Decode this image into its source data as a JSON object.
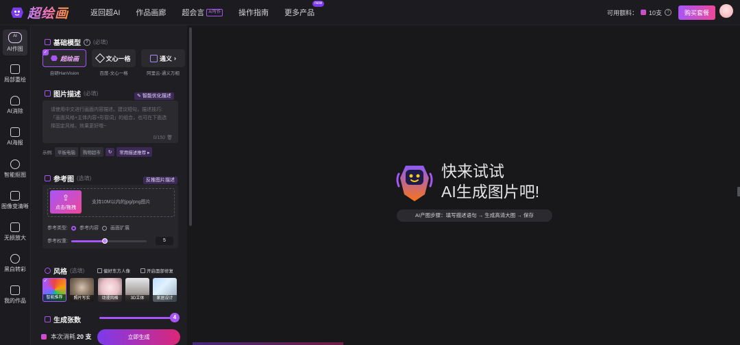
{
  "topbar": {
    "logo_text": "超绘画",
    "nav": [
      {
        "label": "返回超AI"
      },
      {
        "label": "作品画廊"
      },
      {
        "label": "超会言",
        "badge": "AI写作"
      },
      {
        "label": "操作指南"
      },
      {
        "label": "更多产品",
        "new_badge": "new"
      }
    ],
    "credits_label": "可用额料：",
    "credits_value": "10支",
    "buy_label": "购买套餐"
  },
  "rail": [
    {
      "label": "AI作图",
      "icon": "ai-icon",
      "active": true
    },
    {
      "label": "局部重绘",
      "icon": "edit-icon"
    },
    {
      "label": "AI消除",
      "icon": "eraser-icon"
    },
    {
      "label": "AI海报",
      "icon": "poster-icon"
    },
    {
      "label": "智能抠图",
      "icon": "cutout-icon"
    },
    {
      "label": "图像变清晰",
      "icon": "enhance-icon"
    },
    {
      "label": "无损放大",
      "icon": "upscale-icon"
    },
    {
      "label": "黑白转彩",
      "icon": "colorize-icon"
    },
    {
      "label": "我的作品",
      "icon": "works-icon"
    }
  ],
  "panel": {
    "base_model": {
      "title": "基础模型",
      "hint": "(必填)",
      "models": [
        {
          "name": "超绘画",
          "caption": "自研HanVision",
          "selected": true
        },
        {
          "name": "文心一格",
          "caption": "百度-文心一格"
        },
        {
          "name": "通义",
          "caption": "阿里云-通义万相"
        }
      ]
    },
    "description": {
      "title": "图片描述",
      "hint": "(必填)",
      "smart_button": "智能优化描述",
      "placeholder": "请使用中文进行画面内容描述。建议短句，描述技巧:「画面风格+主体内容+形容词」的组合，也可在下面选择固定风格，效果更好哦~",
      "count": "0/150",
      "examples_label": "示例:",
      "examples": [
        "平板电脑",
        "购物超市"
      ],
      "common_label": "常用描述推荐"
    },
    "reference": {
      "title": "参考图",
      "hint": "(选填)",
      "reverse_button": "反推图片描述",
      "upload_label": "点击/拖拽",
      "upload_hint": "支持10M以内的jpg/png图片",
      "type_label": "参考类型:",
      "type_options": [
        "参考内容",
        "画面扩展"
      ],
      "type_selected": "参考内容",
      "weight_label": "参考权重:",
      "weight_value": "5",
      "weight_fraction": 0.45
    },
    "style": {
      "title": "风格",
      "hint": "(选填)",
      "options": [
        "偏好东方人像",
        "开启面部修复"
      ],
      "cards": [
        {
          "label": "智能推荐",
          "selected": true
        },
        {
          "label": "照片写实"
        },
        {
          "label": "动漫风格"
        },
        {
          "label": "3D立体"
        },
        {
          "label": "家居设计"
        }
      ]
    },
    "count": {
      "title": "生成张数",
      "value": "4",
      "fraction": 1.0
    },
    "cost_label": "本次消耗",
    "cost_value": "20 支",
    "generate_label": "立即生成"
  },
  "canvas": {
    "hero_line1": "快来试试",
    "hero_line2": "AI生成图片吧!",
    "steps": "AI产图步骤：填写描述语句 → 生成高清大图 → 保存"
  },
  "colors": {
    "accent": "#a855f7",
    "accent2": "#ec4899",
    "bg": "#18181b",
    "panel": "#1f1f23"
  }
}
